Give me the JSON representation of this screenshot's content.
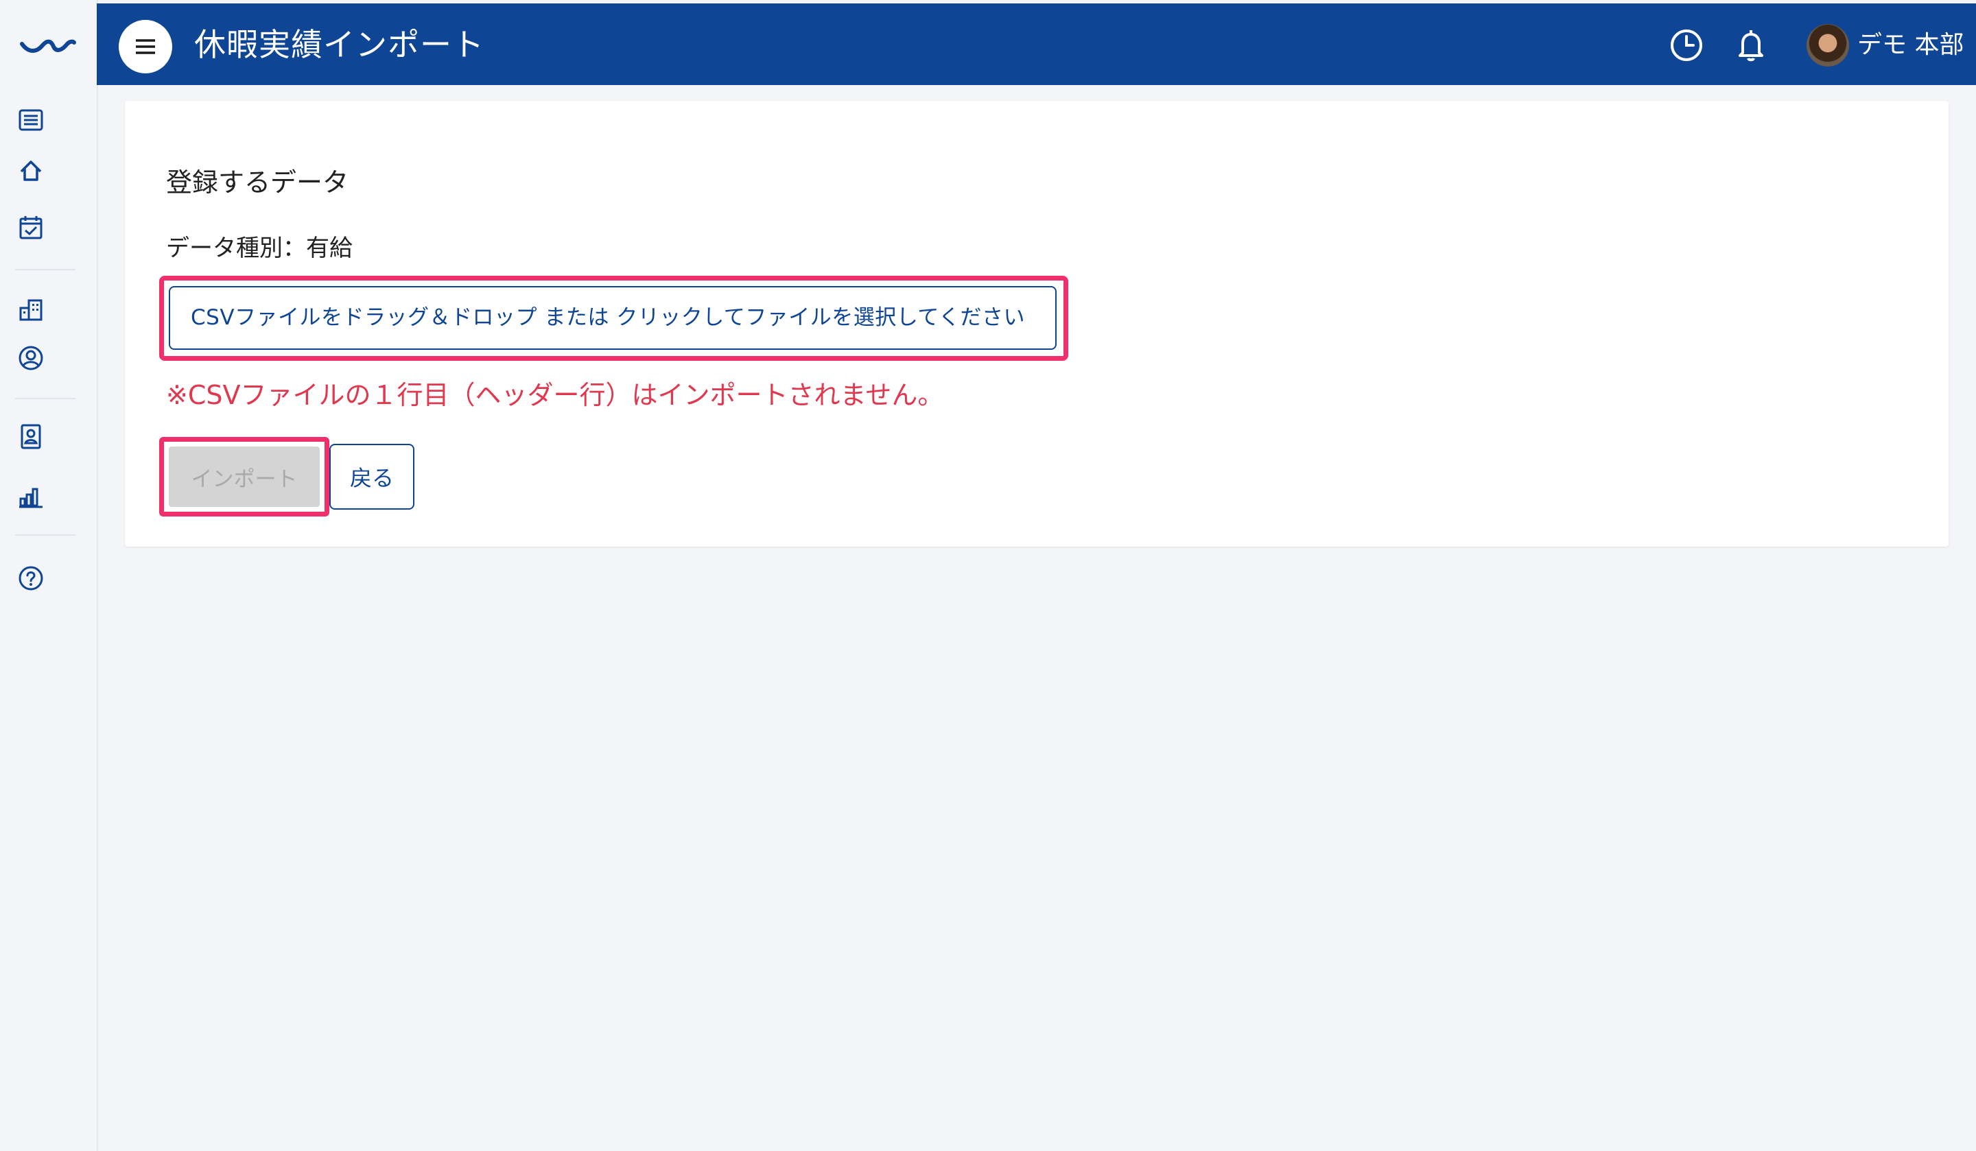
{
  "app": {
    "title": "休暇実績インポート",
    "user_name": "デモ 本部"
  },
  "sidebar": {
    "items": [
      {
        "icon": "list-icon"
      },
      {
        "icon": "home-icon"
      },
      {
        "icon": "calendar-check-icon"
      },
      {
        "icon": "building-icon"
      },
      {
        "icon": "user-circle-icon"
      },
      {
        "icon": "id-badge-icon"
      },
      {
        "icon": "bar-chart-icon"
      },
      {
        "icon": "help-icon"
      }
    ]
  },
  "header": {
    "icons": [
      "menu-icon",
      "clock-icon",
      "bell-icon"
    ]
  },
  "main": {
    "section_title": "登録するデータ",
    "data_type_label": "データ種別：有給",
    "dropzone_text": "CSVファイルをドラッグ＆ドロップ または クリックしてファイルを選択してください",
    "warning_text": "※CSVファイルの１行目（ヘッダー行）はインポートされません。",
    "import_button": "インポート",
    "back_button": "戻る"
  },
  "colors": {
    "header_bg": "#0f4595",
    "accent": "#0f4595",
    "warning": "#e0384f",
    "highlight": "#f0306d",
    "page_bg": "#f4f5f8"
  }
}
